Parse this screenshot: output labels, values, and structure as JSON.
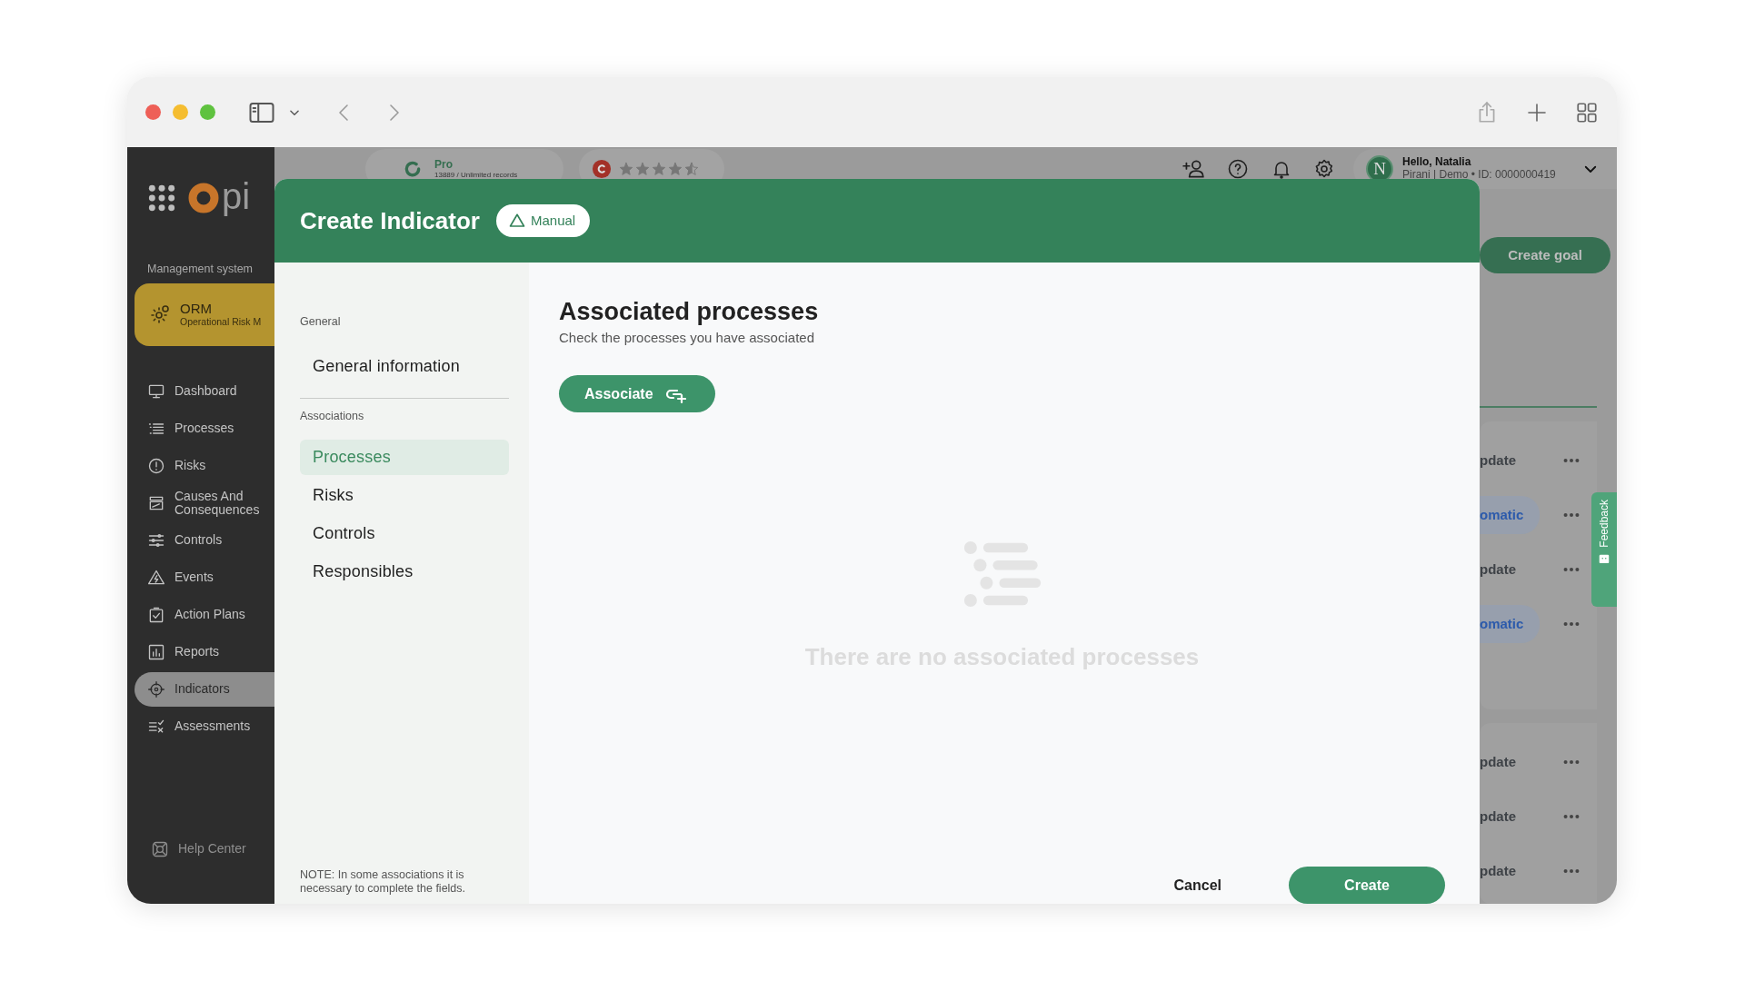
{
  "sidebar": {
    "logo_text": "pi",
    "section_label": "Management system",
    "module": {
      "name": "ORM",
      "subtitle": "Operational Risk M"
    },
    "items": [
      {
        "label": "Dashboard",
        "selected": false
      },
      {
        "label": "Processes",
        "selected": false
      },
      {
        "label": "Risks",
        "selected": false
      },
      {
        "label": "Causes And Consequences",
        "selected": false
      },
      {
        "label": "Controls",
        "selected": false
      },
      {
        "label": "Events",
        "selected": false
      },
      {
        "label": "Action Plans",
        "selected": false
      },
      {
        "label": "Reports",
        "selected": false
      },
      {
        "label": "Indicators",
        "selected": true
      },
      {
        "label": "Assessments",
        "selected": false
      }
    ],
    "help": "Help Center"
  },
  "topbar": {
    "plan": {
      "name": "Pro",
      "records": "13889 / Unlimited records"
    },
    "rating": {
      "stars": 4.5
    },
    "user": {
      "initial": "N",
      "greeting": "Hello, Natalia",
      "account": "Pirani | Demo • ID: 0000000419"
    }
  },
  "background": {
    "create_goal": "Create goal",
    "groups": [
      {
        "rows": [
          {
            "kind": "plain",
            "text": "pdate"
          },
          {
            "kind": "pill",
            "text": "omatic"
          },
          {
            "kind": "plain",
            "text": "pdate"
          },
          {
            "kind": "pill",
            "text": "omatic"
          }
        ]
      },
      {
        "rows": [
          {
            "kind": "plain",
            "text": "pdate"
          },
          {
            "kind": "plain",
            "text": "pdate"
          },
          {
            "kind": "plain",
            "text": "pdate"
          }
        ]
      }
    ],
    "feedback": "Feedback"
  },
  "modal": {
    "title": "Create Indicator",
    "mode": "Manual",
    "nav": [
      {
        "heading": "General",
        "items": [
          {
            "label": "General information",
            "selected": false
          }
        ]
      },
      {
        "heading": "Associations",
        "items": [
          {
            "label": "Processes",
            "selected": true
          },
          {
            "label": "Risks",
            "selected": false
          },
          {
            "label": "Controls",
            "selected": false
          },
          {
            "label": "Responsibles",
            "selected": false
          }
        ]
      }
    ],
    "note": "NOTE: In some associations it is necessary to complete the fields.",
    "section": {
      "title": "Associated processes",
      "subtitle": "Check the processes you have associated",
      "associate_button": "Associate"
    },
    "empty_text": "There are no associated processes",
    "cancel": "Cancel",
    "create": "Create"
  }
}
